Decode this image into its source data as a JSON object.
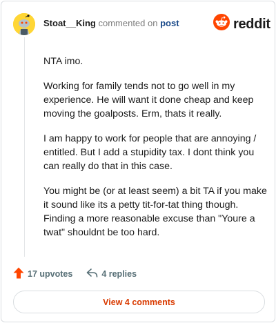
{
  "comment": {
    "author": "Stoat__King",
    "action_text": "commented on",
    "target_link": "post",
    "paragraphs": [
      "NTA imo.",
      "Working for family tends not to go well in my experience. He will want it done cheap and keep moving the goalposts. Erm, thats it really.",
      "I am happy to work for people that are annoying / entitled. But I add a stupidity tax. I dont think you can really do that in this case.",
      "You might be (or at least seem) a bit TA if you make it sound like its a petty tit-for-tat thing though. Finding a more reasonable excuse than \"Youre a twat\" shouldnt be too hard."
    ],
    "upvotes_label": "17 upvotes",
    "replies_label": "4 replies"
  },
  "brand": {
    "logo_text": "reddit",
    "logo_color": "#ff4500"
  },
  "footer": {
    "view_comments_label": "View 4 comments"
  },
  "icons": {
    "avatar": "snoo-avatar-icon",
    "logo": "reddit-logo-icon",
    "upvote": "upvote-arrow-icon",
    "reply": "reply-arrow-icon"
  },
  "colors": {
    "upvote": "#ff4500",
    "accent": "#d93a00",
    "link": "#1a4a8a",
    "avatar_bg": "#ffd635"
  }
}
